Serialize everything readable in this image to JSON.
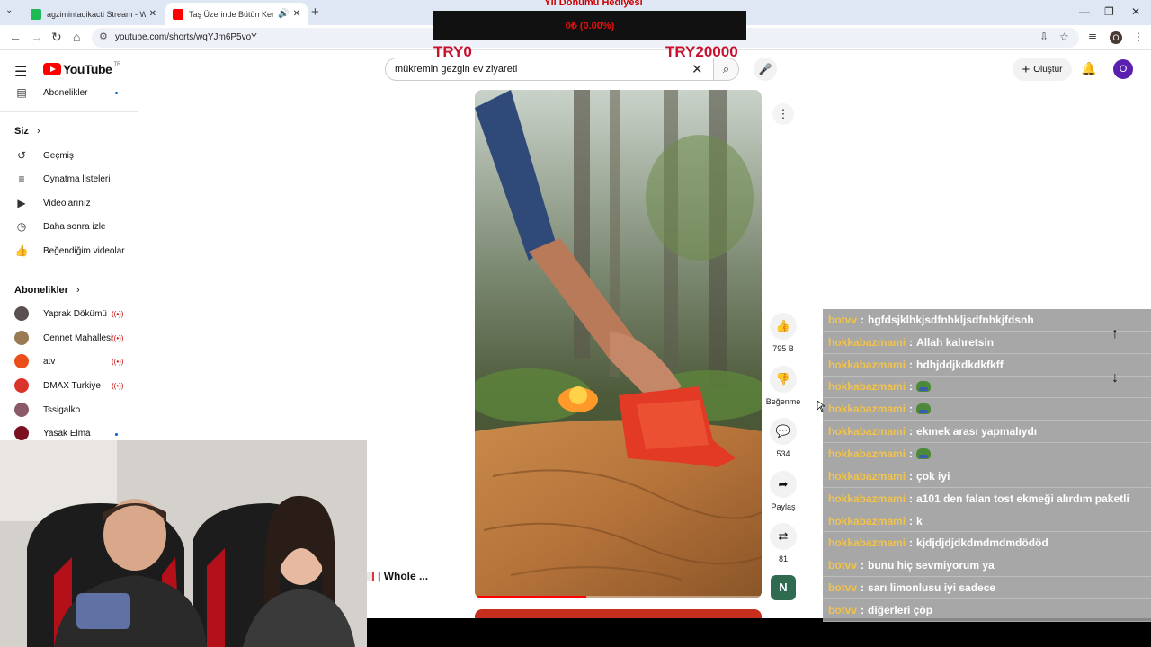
{
  "browser": {
    "tabs": [
      {
        "title": "agzimintadikacti Stream - Watc",
        "active": false,
        "favicon_color": "#1db954"
      },
      {
        "title": "Taş Üzerinde Bütün Kemiksiz",
        "active": true,
        "favicon_color": "#ff0000"
      }
    ],
    "url": "youtube.com/shorts/wqYJm6P5voY",
    "profile_letter": "O"
  },
  "youtube": {
    "region_badge": "TR",
    "logo_text": "YouTube",
    "search_query": "mükremin gezgin ev ziyareti",
    "create_label": "Oluştur",
    "avatar_letter": "O"
  },
  "sidebar": {
    "top_item": "Abonelikler",
    "you_header": "Siz",
    "you_items": [
      {
        "label": "Geçmiş",
        "icon": "history-icon"
      },
      {
        "label": "Oynatma listeleri",
        "icon": "playlist-icon"
      },
      {
        "label": "Videolarınız",
        "icon": "your-videos-icon"
      },
      {
        "label": "Daha sonra izle",
        "icon": "watch-later-icon"
      },
      {
        "label": "Beğendiğim videolar",
        "icon": "liked-icon"
      }
    ],
    "subs_header": "Abonelikler",
    "channels": [
      {
        "name": "Yaprak Dökümü",
        "status": "live",
        "color": "#5a5050"
      },
      {
        "name": "Cennet Mahallesi",
        "status": "live",
        "color": "#9a7a55"
      },
      {
        "name": "atv",
        "status": "live",
        "color": "#e94e1b"
      },
      {
        "name": "DMAX Turkiye",
        "status": "live",
        "color": "#d9332a"
      },
      {
        "name": "Tssigalko",
        "status": "none",
        "color": "#8a5a66"
      },
      {
        "name": "Yasak Elma",
        "status": "new",
        "color": "#7a1020"
      }
    ]
  },
  "donation": {
    "title": "Yıl Dönümü Hediyesi",
    "percent_text": "0₺ (0.00%)",
    "progress": 0,
    "min_label": "TRY0",
    "max_label": "TRY20000"
  },
  "short": {
    "likes": "795 B",
    "dislike_label": "Beğenme",
    "comments": "534",
    "share_label": "Paylaş",
    "remix_count": "81",
    "music_letter": "N",
    "playback_progress": 0.39,
    "next_title": "| Whole ..."
  },
  "chat": [
    {
      "user": "botvv",
      "message": "hgfdsjklhkjsdfnhkljsdfnhkjfdsnh",
      "emote": false
    },
    {
      "user": "hokkabazmami",
      "message": "Allah kahretsin",
      "emote": false
    },
    {
      "user": "hokkabazmami",
      "message": "hdhjddjkdkdkfkff",
      "emote": false
    },
    {
      "user": "hokkabazmami",
      "message": "",
      "emote": true
    },
    {
      "user": "hokkabazmami",
      "message": "",
      "emote": true
    },
    {
      "user": "hokkabazmami",
      "message": "ekmek arası yapmalıydı",
      "emote": false
    },
    {
      "user": "hokkabazmami",
      "message": "",
      "emote": true
    },
    {
      "user": "hokkabazmami",
      "message": "çok iyi",
      "emote": false
    },
    {
      "user": "hokkabazmami",
      "message": "a101 den falan tost ekmeği alırdım paketli",
      "emote": false
    },
    {
      "user": "hokkabazmami",
      "message": "k",
      "emote": false
    },
    {
      "user": "hokkabazmami",
      "message": "kjdjdjdjdkdmdmdmdödöd",
      "emote": false
    },
    {
      "user": "botvv",
      "message": "bunu hiç sevmiyorum ya",
      "emote": false
    },
    {
      "user": "botvv",
      "message": "sarı limonlusu iyi sadece",
      "emote": false
    },
    {
      "user": "botvv",
      "message": "diğerleri çöp",
      "emote": false
    }
  ],
  "colors": {
    "chat_user": "#f3c34a",
    "donation_red": "#c8102e",
    "yt_red": "#ff0000"
  }
}
